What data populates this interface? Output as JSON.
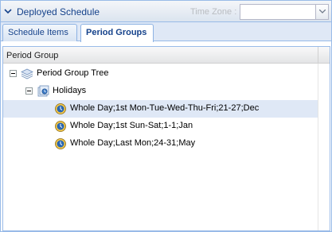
{
  "header": {
    "title": "Deployed Schedule",
    "timezone_label": "Time Zone :",
    "timezone_value": ""
  },
  "tabs": [
    {
      "label": "Schedule Items",
      "active": false
    },
    {
      "label": "Period Groups",
      "active": true
    }
  ],
  "panel": {
    "column_header": "Period Group"
  },
  "tree": {
    "root": {
      "label": "Period Group Tree",
      "icon": "layers-icon",
      "expanded": true
    },
    "group": {
      "label": "Holidays",
      "icon": "calendar-group-icon",
      "expanded": true
    },
    "items": [
      {
        "label": "Whole Day;1st Mon-Tue-Wed-Thu-Fri;21-27;Dec",
        "icon": "clock-icon",
        "selected": true
      },
      {
        "label": "Whole Day;1st Sun-Sat;1-1;Jan",
        "icon": "clock-icon",
        "selected": false
      },
      {
        "label": "Whole Day;Last Mon;24-31;May",
        "icon": "clock-icon",
        "selected": false
      }
    ]
  },
  "colors": {
    "accent_text": "#15428b",
    "border": "#99bbe8",
    "selection": "#dfe8f6"
  }
}
